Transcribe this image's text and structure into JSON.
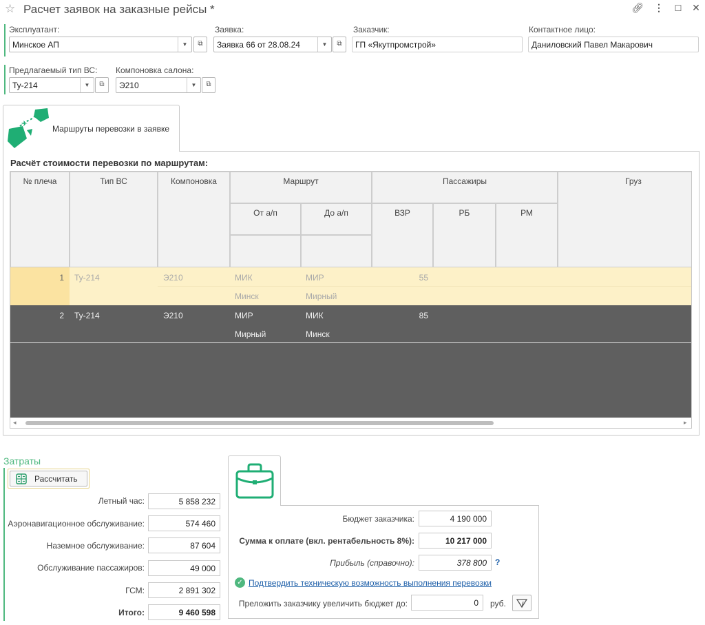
{
  "window": {
    "title": "Расчет заявок на заказные рейсы *"
  },
  "form": {
    "operator_label": "Эксплуатант:",
    "operator_value": "Минское АП",
    "request_label": "Заявка:",
    "request_value": "Заявка 66 от 28.08.24",
    "customer_label": "Заказчик:",
    "customer_value": "ГП «Якутпромстрой»",
    "contact_label": "Контактное лицо:",
    "contact_value": "Даниловский Павел Макарович",
    "aircraft_type_label": "Предлагаемый тип ВС:",
    "aircraft_type_value": "Ту-214",
    "layout_label": "Компоновка салона:",
    "layout_value": "Э210"
  },
  "routes_tab": {
    "label": "Маршруты перевозки в заявке"
  },
  "routes_table": {
    "title": "Расчёт стоимости перевозки по маршрутам:",
    "headers": {
      "leg": "№ плеча",
      "aircraft": "Тип ВС",
      "layout": "Компоновка",
      "route": "Маршрут",
      "from": "От а/п",
      "to": "До а/п",
      "passengers": "Пассажиры",
      "adult": "ВЗР",
      "child": "РБ",
      "infant": "РМ",
      "cargo": "Груз"
    },
    "rows": [
      {
        "leg": "1",
        "aircraft": "Ту-214",
        "layout": "Э210",
        "from_code": "МИК",
        "from_name": "Минск",
        "to_code": "МИР",
        "to_name": "Мирный",
        "adult": "55"
      },
      {
        "leg": "2",
        "aircraft": "Ту-214",
        "layout": "Э210",
        "from_code": "МИР",
        "from_name": "Мирный",
        "to_code": "МИК",
        "to_name": "Минск",
        "adult": "85"
      }
    ]
  },
  "costs": {
    "section_title": "Затраты",
    "calc_button": "Рассчитать",
    "items": [
      {
        "label": "Летный час:",
        "value": "5 858 232"
      },
      {
        "label": "Аэронавигационное обслуживание:",
        "value": "574 460"
      },
      {
        "label": "Наземное обслуживание:",
        "value": "87 604"
      },
      {
        "label": "Обслуживание пассажиров:",
        "value": "49 000"
      },
      {
        "label": "ГСМ:",
        "value": "2 891 302"
      }
    ],
    "total_label": "Итого:",
    "total_value": "9 460 598"
  },
  "payment": {
    "budget_label": "Бюджет заказчика:",
    "budget_value": "4 190 000",
    "sum_label": "Сумма к оплате (вкл. рентабельность 8%):",
    "sum_value": "10 217 000",
    "profit_label": "Прибыль (справочно):",
    "profit_value": "378 800",
    "help": "?",
    "confirm_link": "Подтвердить техническую возможность выполнения перевозки",
    "offer_label": "Преложить заказчику увеличить бюджет до:",
    "offer_value": "0",
    "currency": "руб."
  },
  "colors": {
    "accent": "#4fb87f",
    "selected_row": "#fdf1c8",
    "dark_row": "#5f5f5f",
    "link": "#1c5ea8"
  }
}
